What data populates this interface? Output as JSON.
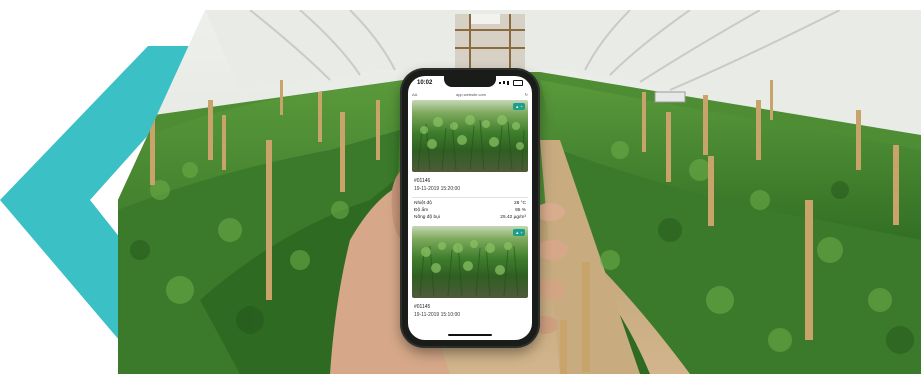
{
  "phone": {
    "time": "10:02",
    "url": "app.website.com",
    "cards": [
      {
        "id": "#01146",
        "timestamp": "19-11-2019 15:20:00",
        "metrics": [
          {
            "label": "Nhiệt độ",
            "value": "28 °C"
          },
          {
            "label": "Độ ẩm",
            "value": "95 %"
          },
          {
            "label": "Nồng độ bụi",
            "value": "25.42 µg/m³"
          }
        ]
      },
      {
        "id": "#01145",
        "timestamp": "19-11-2019 15:10:00"
      }
    ]
  },
  "colors": {
    "accent_teal": "#3bc0c5",
    "fab": "#1b9e8a",
    "plant_green": "#3e7e2c"
  }
}
